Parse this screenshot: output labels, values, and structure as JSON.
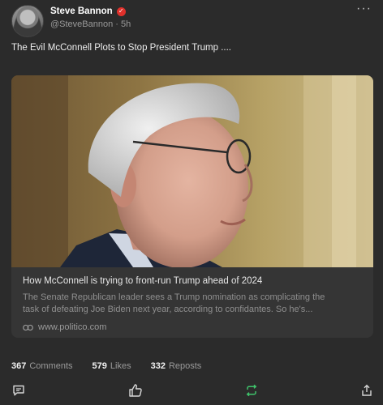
{
  "author": {
    "name": "Steve Bannon",
    "handle": "@SteveBannon",
    "time": "5h",
    "verified_color": "#e0302b"
  },
  "post": {
    "text": "The Evil McConnell Plots to Stop President Trump ...."
  },
  "link_card": {
    "title": "How McConnell is trying to front-run Trump ahead of 2024",
    "description_line1": "The Senate Republican leader sees a Trump nomination as complicating the",
    "description_line2": "task of defeating Joe Biden next year, according to confidantes. So he's...",
    "domain": "www.politico.com"
  },
  "stats": {
    "comments_count": "367",
    "comments_label": "Comments",
    "likes_count": "579",
    "likes_label": "Likes",
    "reposts_count": "332",
    "reposts_label": "Reposts"
  },
  "icons": {
    "more": "more-options-icon",
    "link": "link-icon",
    "comment": "comment-icon",
    "like": "thumbs-up-icon",
    "repost": "repost-icon",
    "share": "share-icon"
  },
  "colors": {
    "background": "#2b2b2b",
    "repost_accent": "#3fc36b"
  }
}
